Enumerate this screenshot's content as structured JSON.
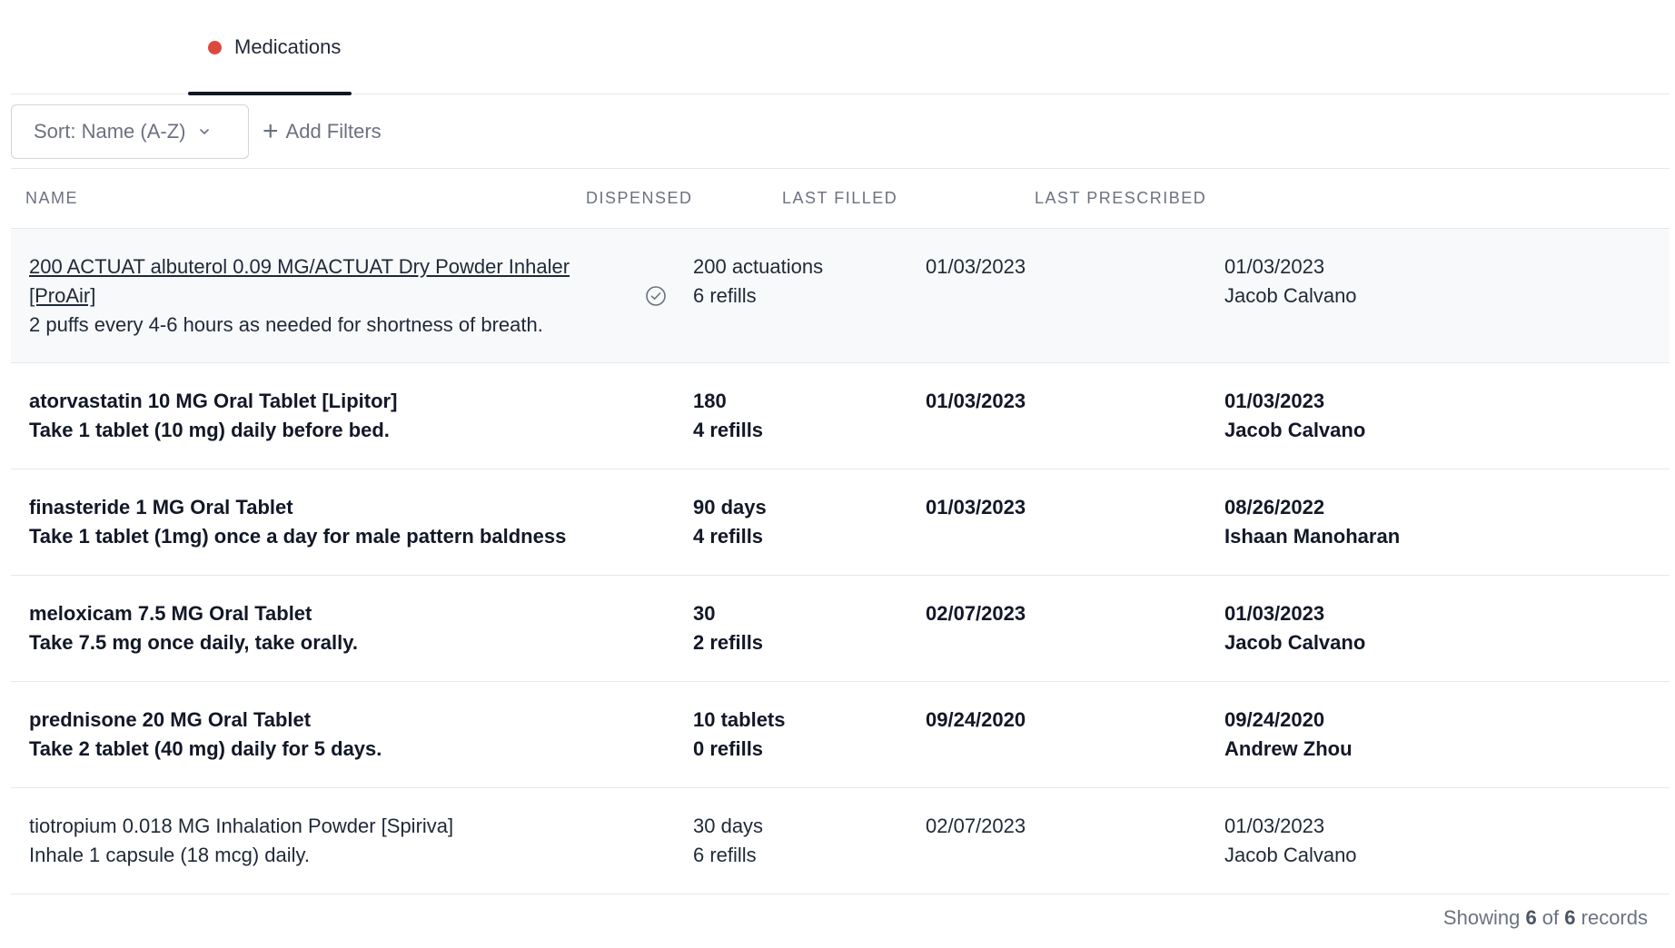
{
  "tabs": [
    {
      "label": "Medications",
      "dot_color": "#dc4a3d",
      "active": true
    }
  ],
  "toolbar": {
    "sort_prefix": "Sort: ",
    "sort_value": "Name (A-Z)",
    "add_filters_label": "Add Filters"
  },
  "table": {
    "headers": [
      "NAME",
      "DISPENSED",
      "LAST FILLED",
      "LAST PRESCRIBED"
    ],
    "rows": [
      {
        "name": "200 ACTUAT albuterol 0.09 MG/ACTUAT Dry Powder Inhaler [ProAir]",
        "instructions": "2 puffs every 4-6 hours as needed for shortness of breath.",
        "dispensed": "200 actuations",
        "refills": "6 refills",
        "last_filled": "01/03/2023",
        "last_prescribed": "01/03/2023",
        "prescriber": "Jacob Calvano"
      },
      {
        "name": "atorvastatin 10 MG Oral Tablet [Lipitor]",
        "instructions": "Take 1 tablet (10 mg) daily before bed.",
        "dispensed": "180",
        "refills": "4 refills",
        "last_filled": "01/03/2023",
        "last_prescribed": "01/03/2023",
        "prescriber": "Jacob Calvano"
      },
      {
        "name": "finasteride 1 MG Oral Tablet",
        "instructions": "Take 1 tablet (1mg) once a day for male pattern baldness",
        "dispensed": "90 days",
        "refills": "4 refills",
        "last_filled": "01/03/2023",
        "last_prescribed": "08/26/2022",
        "prescriber": "Ishaan Manoharan"
      },
      {
        "name": "meloxicam 7.5 MG Oral Tablet",
        "instructions": "Take 7.5 mg once daily, take orally.",
        "dispensed": "30",
        "refills": "2 refills",
        "last_filled": "02/07/2023",
        "last_prescribed": "01/03/2023",
        "prescriber": "Jacob Calvano"
      },
      {
        "name": "prednisone 20 MG Oral Tablet",
        "instructions": "Take 2 tablet (40 mg) daily for 5 days.",
        "dispensed": "10 tablets",
        "refills": "0 refills",
        "last_filled": "09/24/2020",
        "last_prescribed": "09/24/2020",
        "prescriber": "Andrew Zhou"
      },
      {
        "name": "tiotropium 0.018 MG Inhalation Powder [Spiriva]",
        "instructions": "Inhale 1 capsule (18 mcg) daily.",
        "dispensed": "30 days",
        "refills": "6 refills",
        "last_filled": "02/07/2023",
        "last_prescribed": "01/03/2023",
        "prescriber": "Jacob Calvano"
      }
    ]
  },
  "footer": {
    "prefix": "Showing ",
    "shown": "6",
    "middle": " of ",
    "total": "6",
    "suffix": " records"
  }
}
